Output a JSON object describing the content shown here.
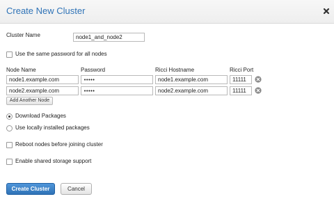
{
  "dialog": {
    "title": "Create New Cluster"
  },
  "cluster_name": {
    "label": "Cluster Name",
    "value": "node1_and_node2"
  },
  "same_password": {
    "label": "Use the same password for all nodes",
    "checked": false
  },
  "nodes_table": {
    "headers": [
      "Node Name",
      "Password",
      "Ricci Hostname",
      "Ricci Port"
    ],
    "rows": [
      {
        "node_name": "node1.example.com",
        "password": "•••••",
        "ricci_hostname": "node1.example.com",
        "ricci_port": "11111"
      },
      {
        "node_name": "node2.example.com",
        "password": "•••••",
        "ricci_hostname": "node2.example.com",
        "ricci_port": "11111"
      }
    ]
  },
  "add_node_button": {
    "label": "Add Another Node"
  },
  "packages": {
    "options": [
      {
        "label": "Download Packages",
        "selected": true
      },
      {
        "label": "Use locally installed packages",
        "selected": false
      }
    ]
  },
  "reboot_nodes": {
    "label": "Reboot nodes before joining cluster",
    "checked": false
  },
  "shared_storage": {
    "label": "Enable shared storage support",
    "checked": false
  },
  "buttons": {
    "create": "Create Cluster",
    "cancel": "Cancel"
  },
  "icons": {
    "close": "close-icon",
    "remove": "remove-circle-icon"
  },
  "colors": {
    "title": "#2f73b7",
    "primary_button": "#2f73b7"
  }
}
